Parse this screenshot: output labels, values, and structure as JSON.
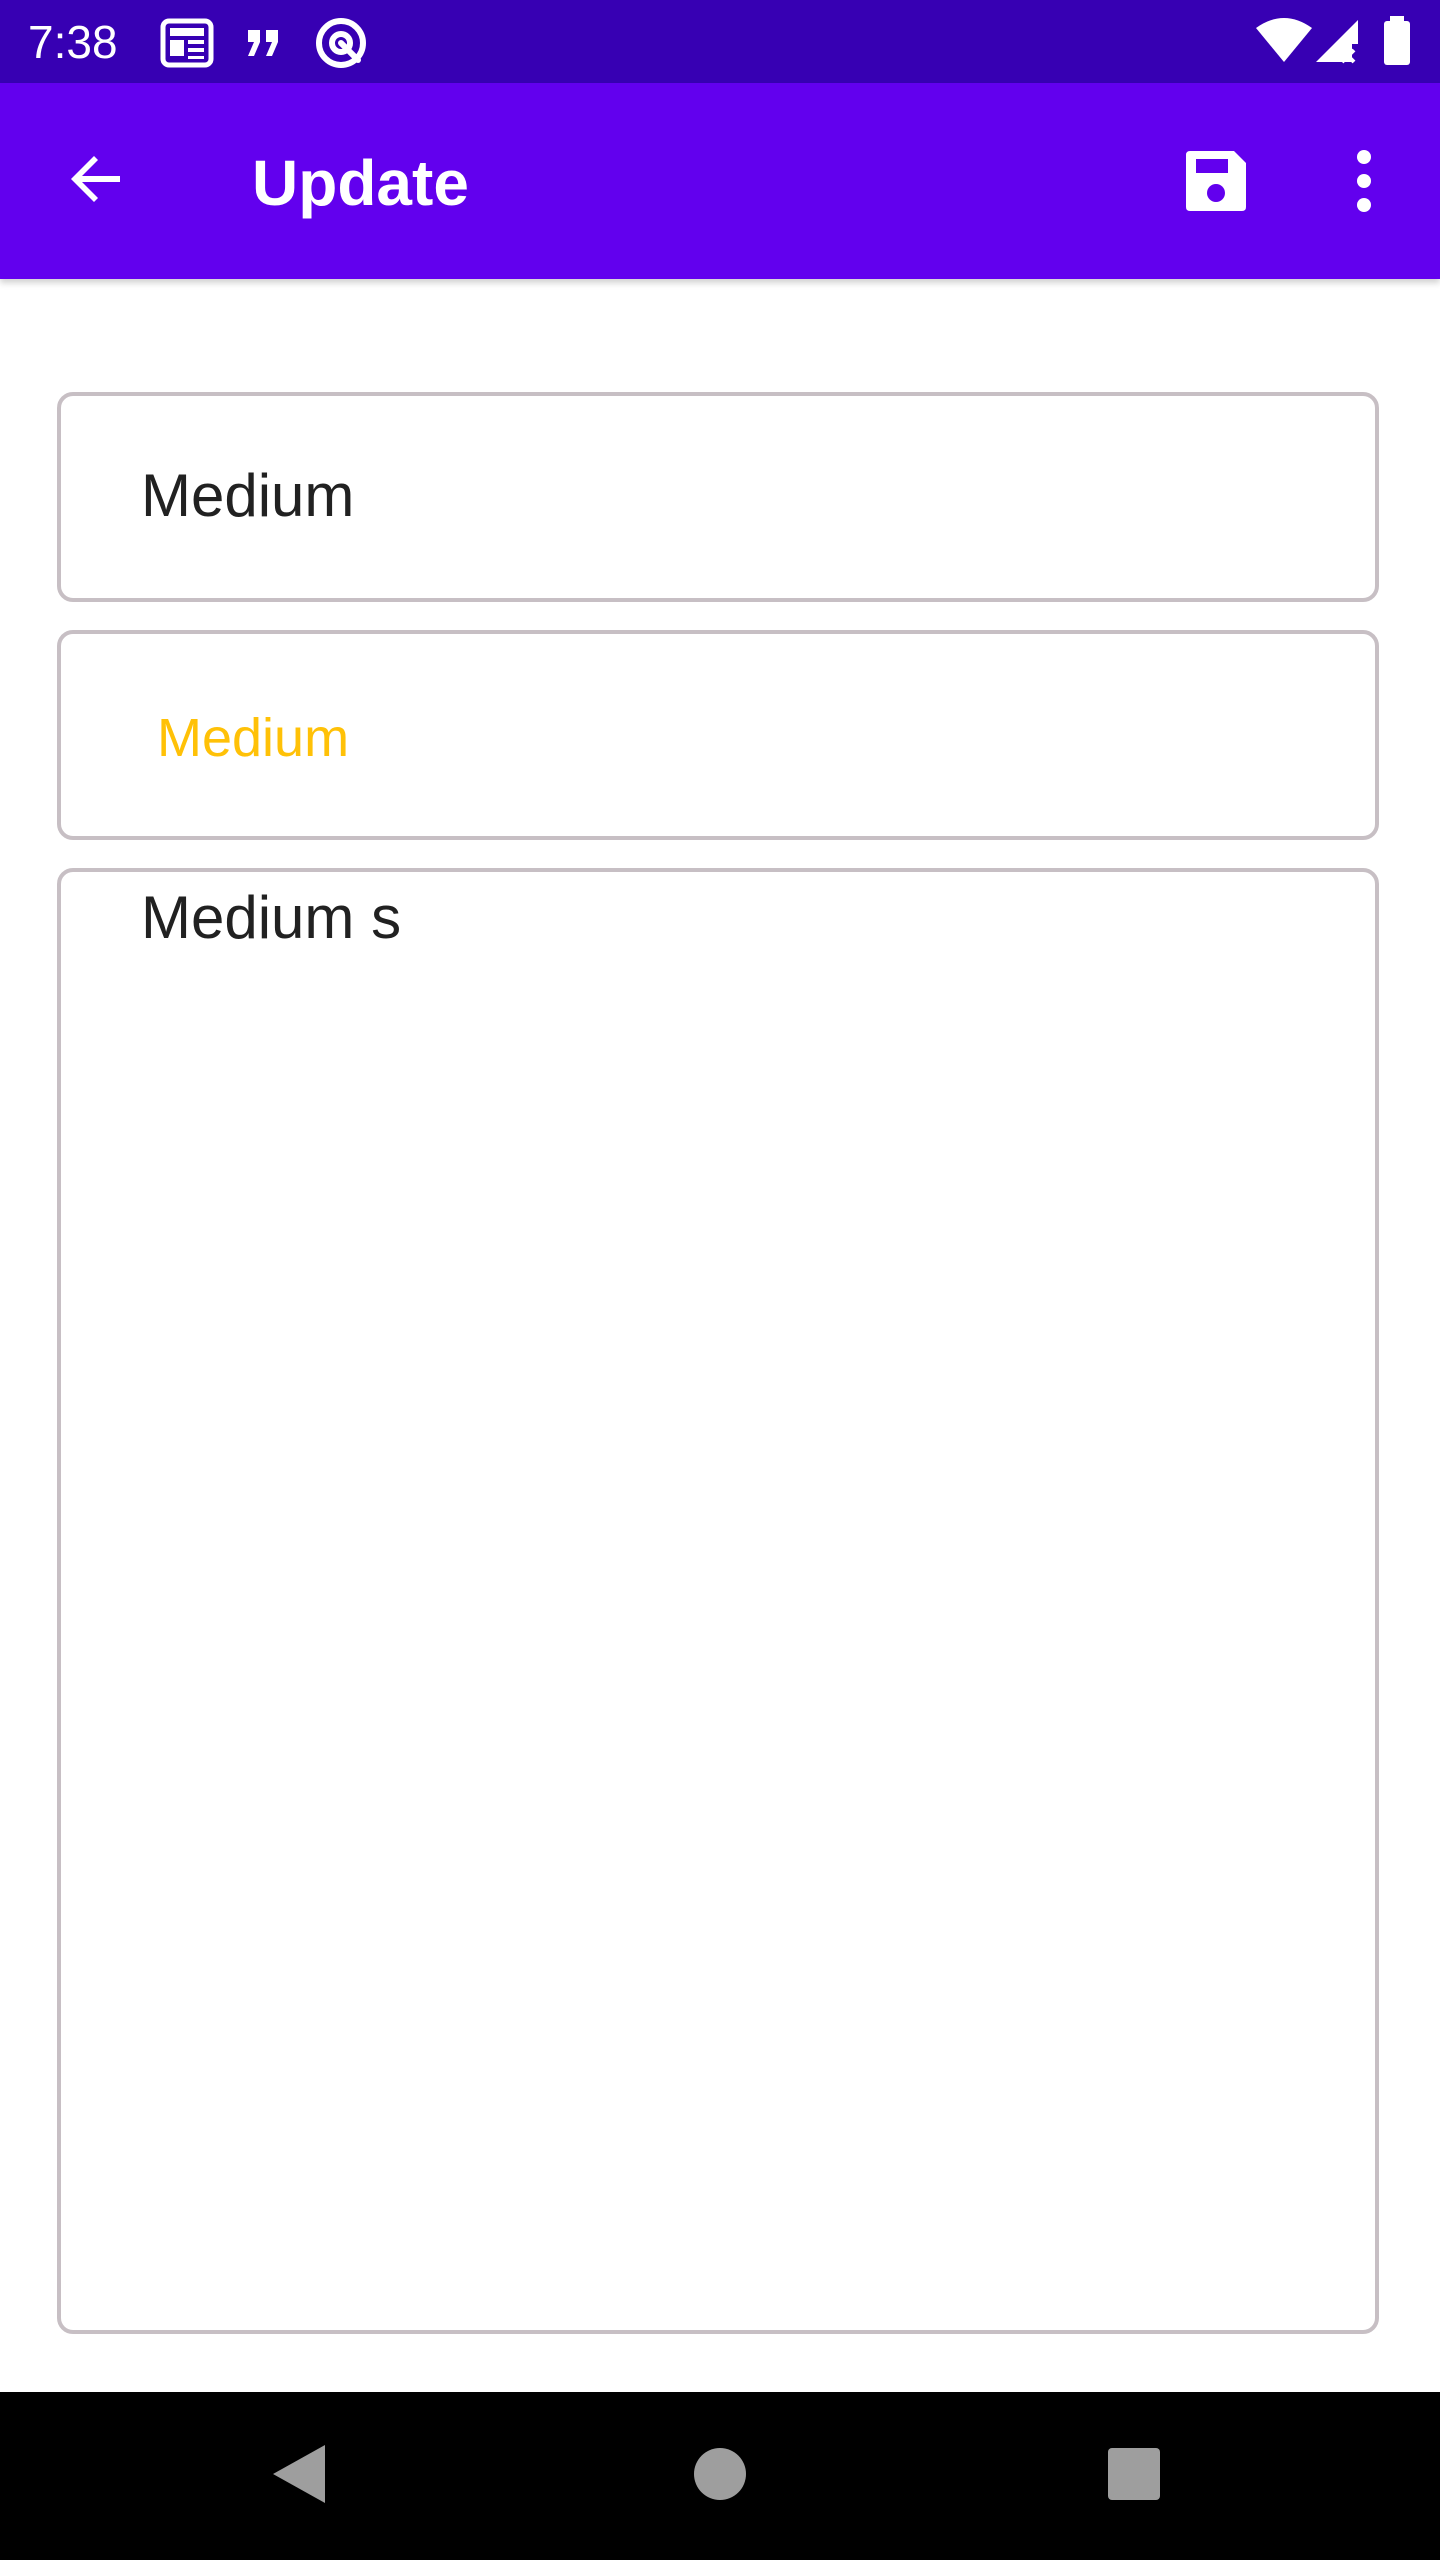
{
  "status_bar": {
    "time": "7:38",
    "notification_icons": [
      "news-icon",
      "quote-icon",
      "at-sign-icon"
    ],
    "system_icons": [
      "wifi-icon",
      "cellular-no-signal-icon",
      "battery-icon"
    ]
  },
  "app_bar": {
    "title": "Update",
    "back_icon": "arrow-back-icon",
    "save_icon": "save-icon",
    "overflow_icon": "more-vert-icon"
  },
  "form": {
    "title_value": "Medium",
    "priority_value": "Medium",
    "priority_color": "#ffc107",
    "description_value": "Medium s"
  },
  "nav_bar": {
    "buttons": [
      "back-triangle-icon",
      "home-circle-icon",
      "recents-square-icon"
    ]
  },
  "colors": {
    "status_bar": "#3700b3",
    "app_bar": "#6200ee",
    "field_border": "#c7bfc4"
  }
}
